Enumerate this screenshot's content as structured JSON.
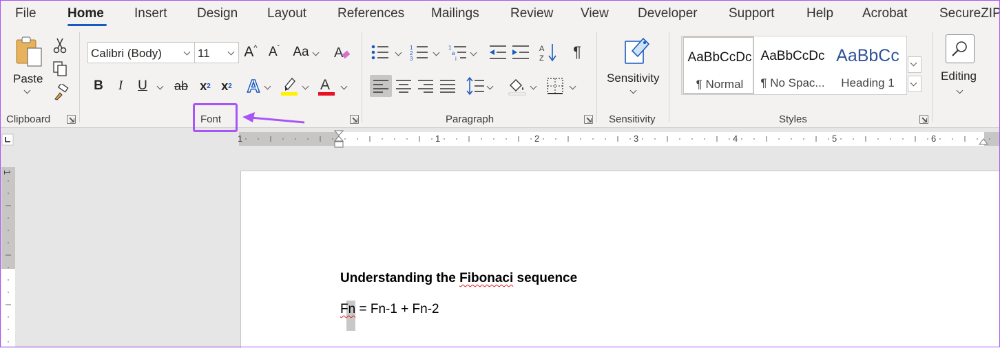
{
  "tabs": [
    "File",
    "Home",
    "Insert",
    "Design",
    "Layout",
    "References",
    "Mailings",
    "Review",
    "View",
    "Developer",
    "Support",
    "Help",
    "Acrobat",
    "SecureZIP"
  ],
  "active_tab": "Home",
  "clipboard": {
    "paste_label": "Paste",
    "group_label": "Clipboard"
  },
  "font": {
    "font_name": "Calibri (Body)",
    "font_size": "11",
    "group_label": "Font",
    "bold": "B",
    "italic": "I",
    "underline": "U",
    "strike": "ab",
    "subscript": "x",
    "superscript": "x",
    "subscript_mark": "2",
    "superscript_mark": "2",
    "grow": "A",
    "shrink": "A",
    "change_case": "Aa",
    "highlight_color": "#fff200",
    "font_color": "#e81123"
  },
  "paragraph": {
    "group_label": "Paragraph"
  },
  "sensitivity": {
    "label": "Sensitivity",
    "group_label": "Sensitivity"
  },
  "styles": {
    "group_label": "Styles",
    "items": [
      {
        "preview": "AaBbCcDc",
        "name": "¶ Normal"
      },
      {
        "preview": "AaBbCcDc",
        "name": "¶ No Spac..."
      },
      {
        "preview": "AaBbCc",
        "name": "Heading 1"
      }
    ]
  },
  "editing": {
    "label": "Editing"
  },
  "ruler": {
    "h_numbers": [
      "1",
      "1",
      "2",
      "3",
      "4",
      "5",
      "6"
    ],
    "v_numbers": [
      "1"
    ]
  },
  "document": {
    "title_prefix": "Understanding the ",
    "title_word": "Fibonaci",
    "title_suffix": " sequence",
    "formula_fn": "Fn",
    "formula_rest": " = Fn-1 + Fn-2"
  },
  "colors": {
    "accent": "#185abd",
    "annotation": "#a855f7"
  }
}
